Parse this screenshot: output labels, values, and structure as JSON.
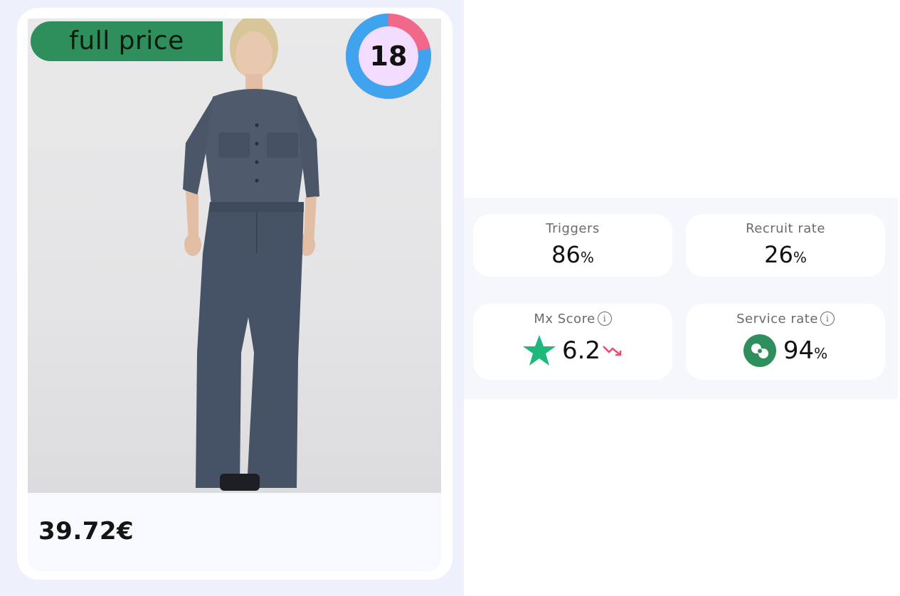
{
  "product": {
    "tag_label": "full price",
    "badge_count": "18",
    "price": "39.72€",
    "image_alt": "woman in denim jumpsuit",
    "colors": {
      "tag": "#2f8f5c",
      "ring_primary": "#3fa3ee",
      "ring_secondary": "#f2688a",
      "ring_fill": "#f2dcff"
    },
    "ring_progress": 0.78
  },
  "metrics": {
    "triggers": {
      "label": "Triggers",
      "value": "86",
      "unit": "%"
    },
    "recruit_rate": {
      "label": "Recruit rate",
      "value": "26",
      "unit": "%"
    },
    "mx_score": {
      "label": "Mx Score",
      "value": "6.2",
      "trend": "down",
      "info_icon": "i"
    },
    "service_rate": {
      "label": "Service rate",
      "value": "94",
      "unit": "%",
      "info_icon": "i"
    },
    "colors": {
      "star": "#1db87c",
      "trend_down": "#ef4b6c",
      "service_icon": "#2f8f5c"
    }
  }
}
